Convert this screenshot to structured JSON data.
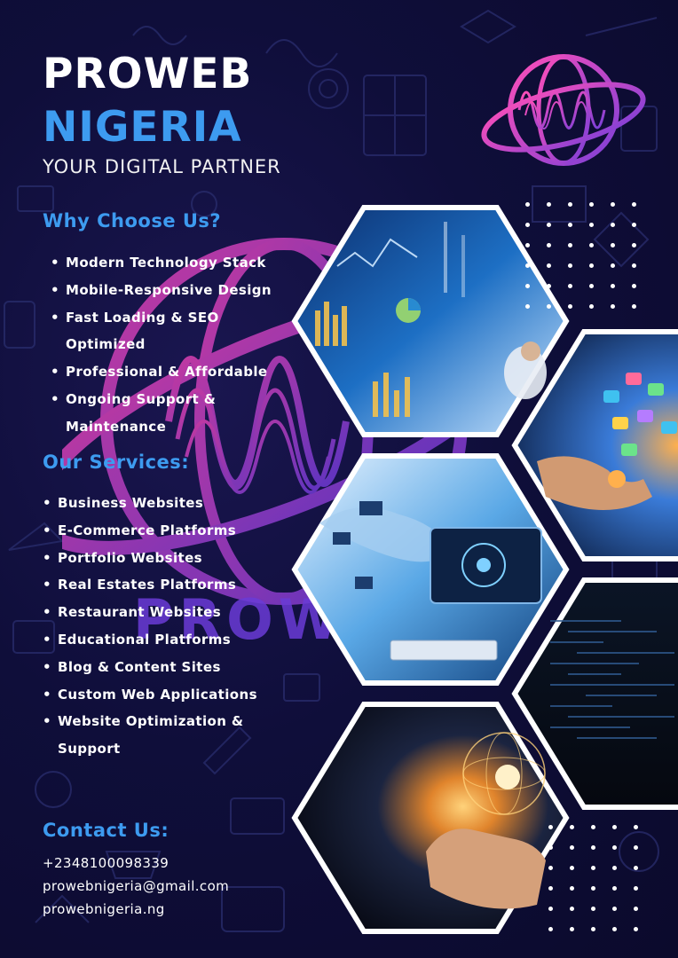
{
  "brand": {
    "title_line1": "PROWEB",
    "title_line2": "NIGERIA",
    "tagline": "YOUR DIGITAL PARTNER",
    "watermark_text": "PROWEB"
  },
  "why": {
    "heading": "Why Choose Us?",
    "items": [
      [
        "Modern Technology Stack"
      ],
      [
        "Mobile-Responsive Design"
      ],
      [
        "Fast Loading & SEO",
        "Optimized"
      ],
      [
        "Professional & Affordable"
      ],
      [
        "Ongoing Support &",
        "Maintenance"
      ]
    ]
  },
  "services": {
    "heading": "Our Services:",
    "items": [
      [
        "Business Websites"
      ],
      [
        "E-Commerce Platforms"
      ],
      [
        "Portfolio Websites"
      ],
      [
        "Real Estates Platforms"
      ],
      [
        "Restaurant Websites"
      ],
      [
        "Educational Platforms"
      ],
      [
        " Blog & Content Sites"
      ],
      [
        "Custom Web Applications"
      ],
      [
        "Website Optimization &",
        "Support"
      ]
    ]
  },
  "contact": {
    "heading": "Contact Us:",
    "phone": "+2348100098339",
    "email": "prowebnigeria@gmail.com",
    "website": "prowebnigeria.ng"
  },
  "images": [
    {
      "name": "analytics-dashboard-image"
    },
    {
      "name": "mobile-apps-hand-image"
    },
    {
      "name": "global-network-computer-image"
    },
    {
      "name": "code-screen-image"
    },
    {
      "name": "glowing-globe-hand-image"
    }
  ],
  "icons": {
    "logo": "wireframe-globe-wave-logo",
    "bullet": "•"
  },
  "colors": {
    "background": "#0f0e3a",
    "accent_blue": "#3d9bf0",
    "accent_pink": "#e040b0",
    "accent_purple": "#7b3fd8"
  }
}
